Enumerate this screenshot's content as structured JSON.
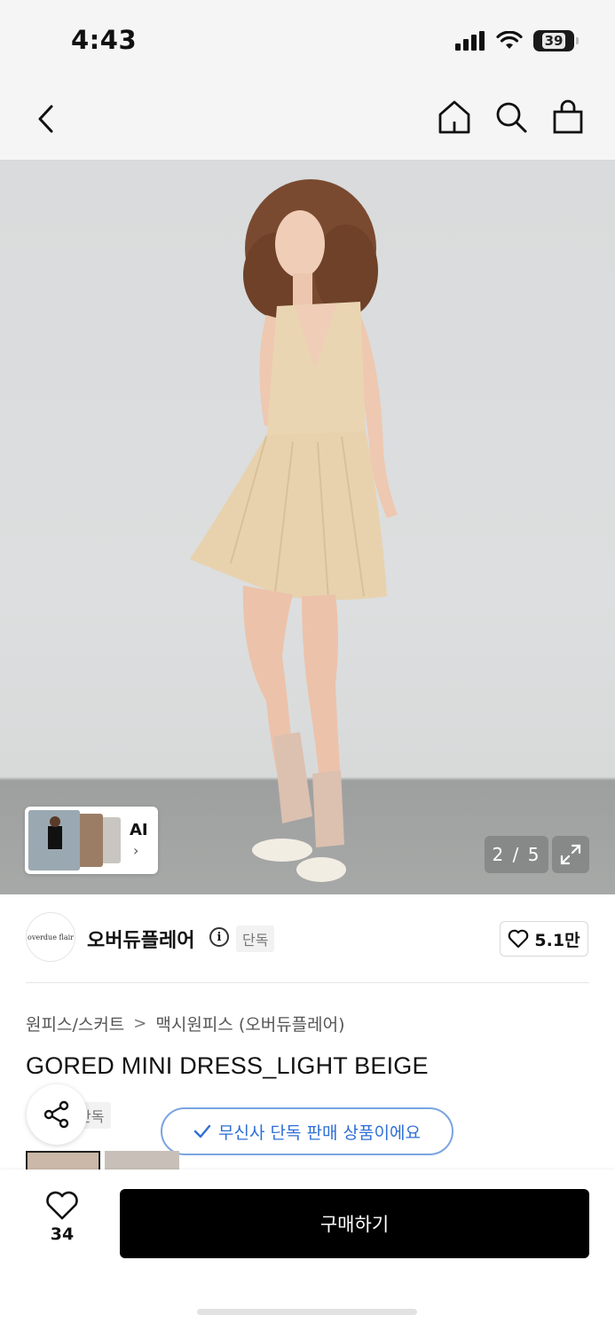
{
  "status_bar": {
    "time": "4:43",
    "battery": "39"
  },
  "icons": {
    "back": "chevron-left-icon",
    "home": "home-icon",
    "search": "search-icon",
    "bag": "shopping-bag-icon",
    "expand": "expand-icon",
    "share": "share-icon",
    "heart": "heart-icon",
    "info": "info-icon",
    "check": "check-icon"
  },
  "gallery": {
    "ai_label": "AI",
    "ai_chevron": "›",
    "counter": "2 / 5"
  },
  "brand": {
    "logo_text": "overdue flair",
    "name": "오버듀플레어",
    "badge": "단독",
    "likes": "5.1만"
  },
  "breadcrumb": {
    "category": "원피스/스커트",
    "separator": ">",
    "subcategory": "맥시원피스 (오버듀플레어)"
  },
  "product": {
    "title": "GORED MINI DRESS_LIGHT BEIGE",
    "exclusive_badge": "단독"
  },
  "toast": {
    "message": "무신사 단독 판매 상품이에요"
  },
  "bottom_bar": {
    "wish_count": "34",
    "buy_label": "구매하기"
  },
  "colors": {
    "buy_button": "#000000",
    "toast_accent": "#2f6fd6",
    "dress": "#ead5b3"
  }
}
